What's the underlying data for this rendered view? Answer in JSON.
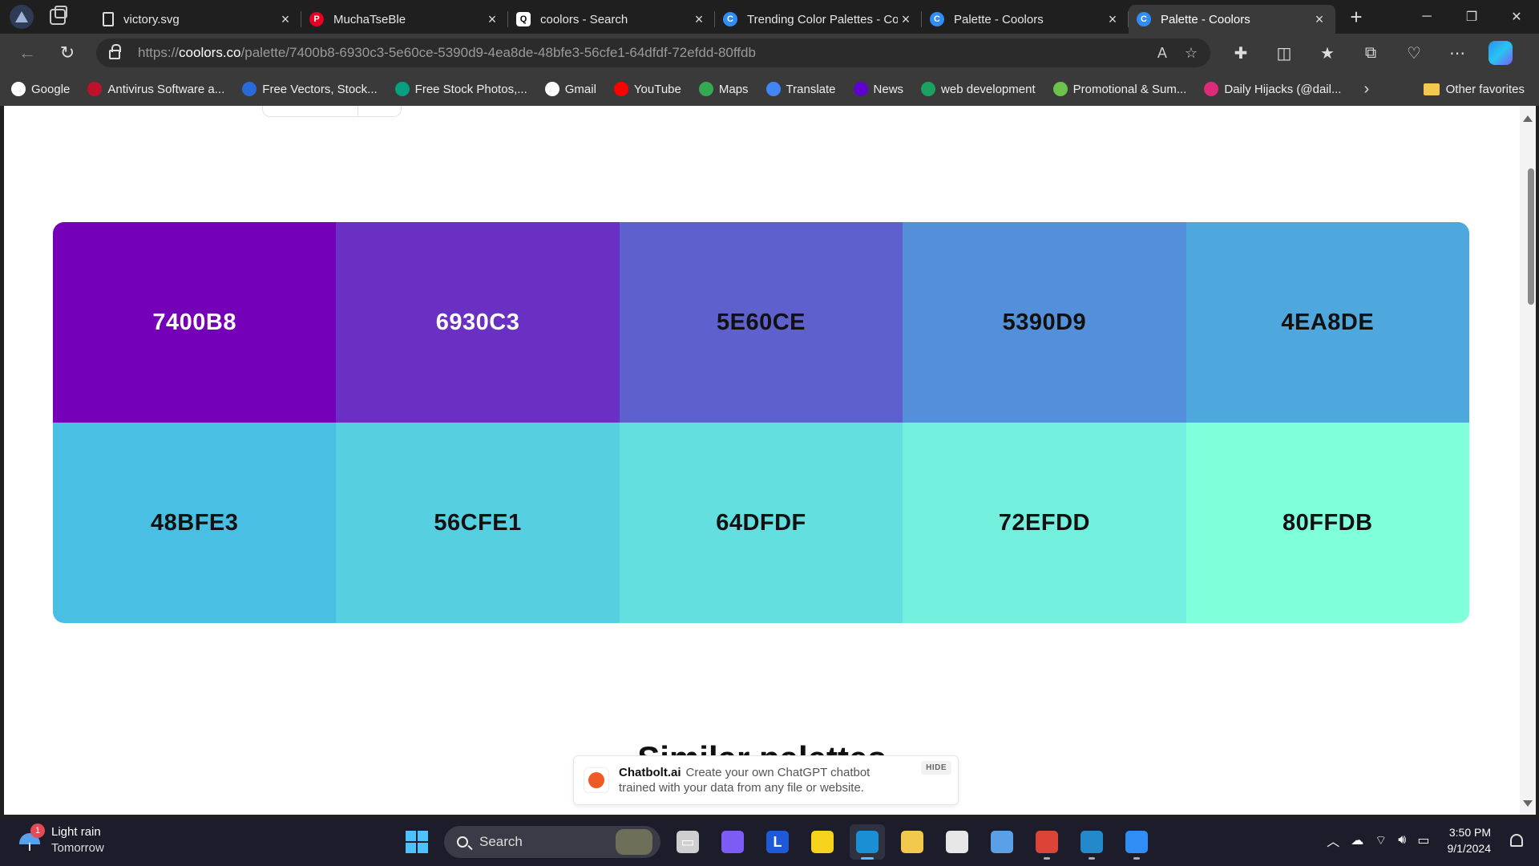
{
  "browser": {
    "tabs": [
      {
        "title": "victory.svg",
        "favicon": "file-icon",
        "active": false
      },
      {
        "title": "MuchaTseBle",
        "favicon": "pinterest-icon",
        "active": false
      },
      {
        "title": "coolors - Search",
        "favicon": "search-icon",
        "active": false
      },
      {
        "title": "Trending Color Palettes - Co",
        "favicon": "coolors-icon",
        "active": false
      },
      {
        "title": "Palette - Coolors",
        "favicon": "coolors-icon",
        "active": false
      },
      {
        "title": "Palette - Coolors",
        "favicon": "coolors-icon",
        "active": true
      }
    ],
    "url": {
      "scheme": "https://",
      "host": "coolors.co",
      "path": "/palette/7400b8-6930c3-5e60ce-5390d9-4ea8de-48bfe3-56cfe1-64dfdf-72efdd-80ffdb"
    },
    "bookmarks": [
      {
        "label": "Google",
        "color": "#ffffff"
      },
      {
        "label": "Antivirus Software a...",
        "color": "#c0112b"
      },
      {
        "label": "Free Vectors, Stock...",
        "color": "#2a6ad8"
      },
      {
        "label": "Free Stock Photos,...",
        "color": "#05a081"
      },
      {
        "label": "Gmail",
        "color": "#ffffff"
      },
      {
        "label": "YouTube",
        "color": "#ff0000"
      },
      {
        "label": "Maps",
        "color": "#34a853"
      },
      {
        "label": "Translate",
        "color": "#4285f4"
      },
      {
        "label": "News",
        "color": "#6001d2"
      },
      {
        "label": "web development",
        "color": "#1aa260"
      },
      {
        "label": "Promotional & Sum...",
        "color": "#6cc24a"
      },
      {
        "label": "Daily Hijacks (@dail...",
        "color": "#dd2a7b"
      }
    ],
    "other_favorites": "Other favorites"
  },
  "page": {
    "palette": [
      {
        "hex": "7400B8",
        "color": "#7400b8",
        "text_color": "#ffffff"
      },
      {
        "hex": "6930C3",
        "color": "#6930c3",
        "text_color": "#ffffff"
      },
      {
        "hex": "5E60CE",
        "color": "#5e60ce",
        "text_color": "#111111"
      },
      {
        "hex": "5390D9",
        "color": "#5390d9",
        "text_color": "#111111"
      },
      {
        "hex": "4EA8DE",
        "color": "#4ea8de",
        "text_color": "#111111"
      },
      {
        "hex": "48BFE3",
        "color": "#48bfe3",
        "text_color": "#111111"
      },
      {
        "hex": "56CFE1",
        "color": "#56cfe1",
        "text_color": "#111111"
      },
      {
        "hex": "64DFDF",
        "color": "#64dfdf",
        "text_color": "#111111"
      },
      {
        "hex": "72EFDD",
        "color": "#72efdd",
        "text_color": "#111111"
      },
      {
        "hex": "80FFDB",
        "color": "#80ffdb",
        "text_color": "#111111"
      }
    ],
    "similar_heading": "Similar palettes"
  },
  "ad": {
    "brand": "Chatbolt.ai",
    "line1": "Create your own ChatGPT chatbot",
    "line2": "trained with your data from any file or website.",
    "hide_label": "HIDE"
  },
  "taskbar": {
    "weather": {
      "condition": "Light rain",
      "when": "Tomorrow",
      "badge": "1"
    },
    "search_label": "Search",
    "apps": [
      {
        "name": "task-view-icon",
        "glyph": "▭",
        "color": "#cfcfcf"
      },
      {
        "name": "copilot-icon",
        "glyph": "",
        "color": "#7d5cf5"
      },
      {
        "name": "l-app-icon",
        "glyph": "L",
        "color": "#1e5ad8"
      },
      {
        "name": "sticky-notes-icon",
        "glyph": "",
        "color": "#f7d21b"
      },
      {
        "name": "edge-icon",
        "glyph": "",
        "color": "#1a8fd4"
      },
      {
        "name": "file-explorer-icon",
        "glyph": "",
        "color": "#f2c94c"
      },
      {
        "name": "store-icon",
        "glyph": "",
        "color": "#e6e6e6"
      },
      {
        "name": "notepad-icon",
        "glyph": "",
        "color": "#5aa0e6"
      },
      {
        "name": "chrome-icon",
        "glyph": "",
        "color": "#db4437"
      },
      {
        "name": "vscode-icon",
        "glyph": "",
        "color": "#2489ca"
      },
      {
        "name": "paint-icon",
        "glyph": "",
        "color": "#2f8df5"
      }
    ],
    "clock": {
      "time": "3:50 PM",
      "date": "9/1/2024"
    }
  }
}
